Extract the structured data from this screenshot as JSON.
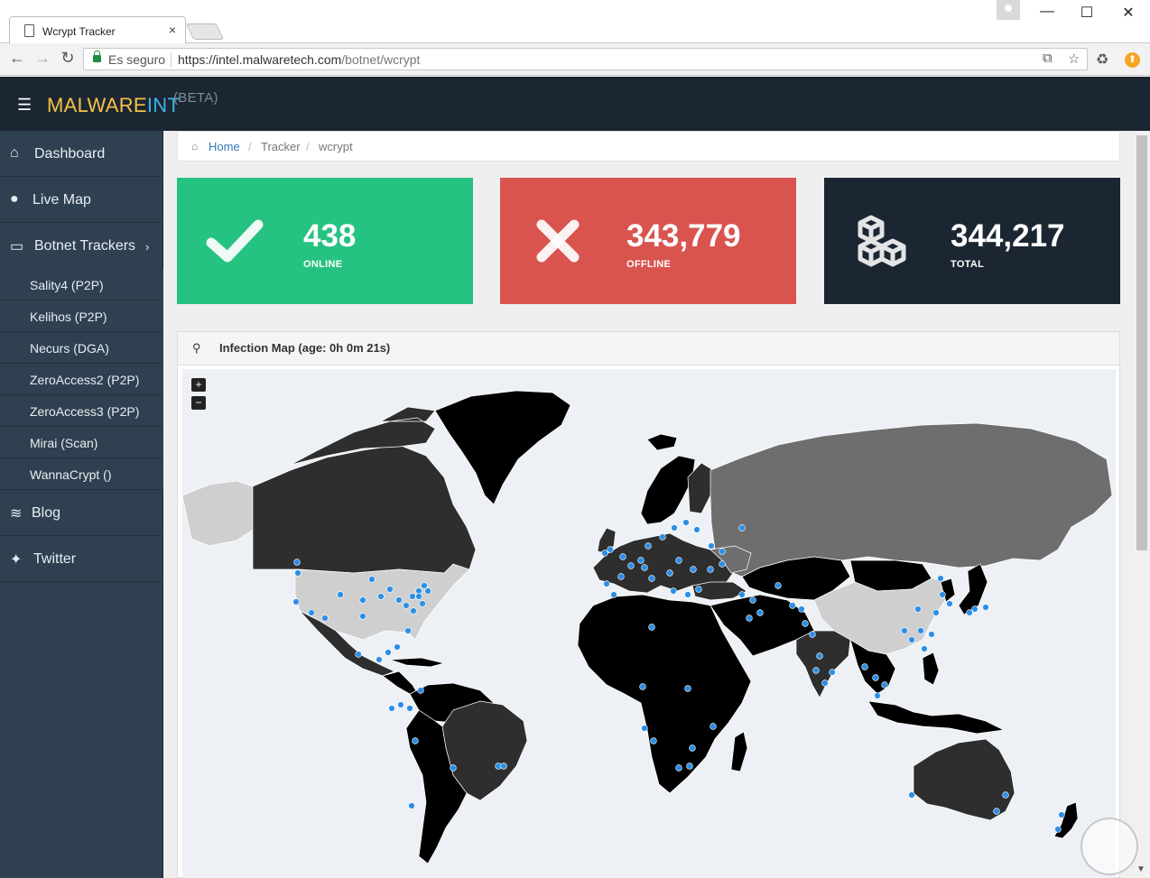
{
  "browser": {
    "tab_title": "Wcrypt Tracker",
    "tab_close": "×",
    "secure_label": "Es seguro",
    "url_host": "https://intel.malwaretech.com",
    "url_path": "/botnet/wcrypt",
    "minimize": "—",
    "maximize": "☐",
    "close": "✕"
  },
  "header": {
    "brand_a": "MALWARE",
    "brand_b": "INT",
    "brand_beta": "(BETA)"
  },
  "sidebar": {
    "items": [
      {
        "label": "Dashboard",
        "icon": "home-icon"
      },
      {
        "label": "Live Map",
        "icon": "globe-icon"
      },
      {
        "label": "Botnet Trackers",
        "icon": "monitor-icon"
      }
    ],
    "sub_items": [
      {
        "label": "Sality4 (P2P)"
      },
      {
        "label": "Kelihos (P2P)"
      },
      {
        "label": "Necurs (DGA)"
      },
      {
        "label": "ZeroAccess2 (P2P)"
      },
      {
        "label": "ZeroAccess3 (P2P)"
      },
      {
        "label": "Mirai (Scan)"
      },
      {
        "label": "WannaCrypt ()"
      }
    ],
    "bottom_items": [
      {
        "label": "Blog",
        "icon": "rss-icon"
      },
      {
        "label": "Twitter",
        "icon": "twitter-icon"
      }
    ]
  },
  "breadcrumb": {
    "home": "Home",
    "tracker": "Tracker",
    "current": "wcrypt",
    "separator": "/"
  },
  "stats": {
    "online": {
      "value": "438",
      "label": "ONLINE",
      "color": "#26c281"
    },
    "offline": {
      "value": "343,779",
      "label": "OFFLINE",
      "color": "#d9534f"
    },
    "total": {
      "value": "344,217",
      "label": "TOTAL",
      "color": "#1c2633"
    }
  },
  "map": {
    "title": "Infection Map (age: 0h 0m 21s)",
    "zoom_in": "+",
    "zoom_out": "−",
    "point_color": "#2b8fe8"
  }
}
